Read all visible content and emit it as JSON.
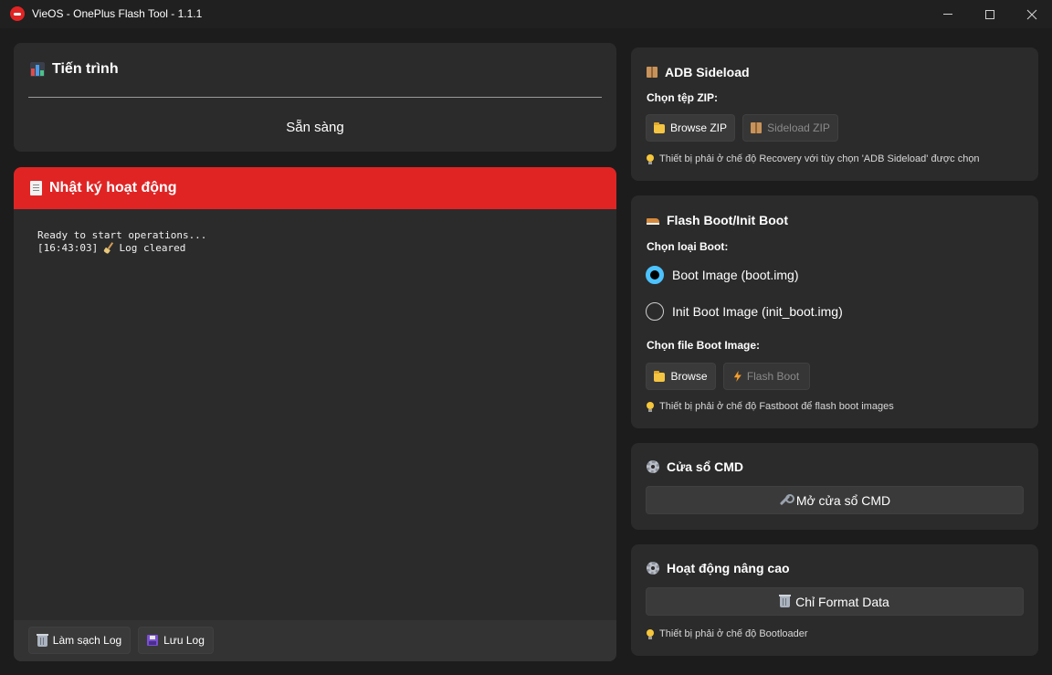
{
  "window": {
    "title": "VieOS - OnePlus Flash Tool - 1.1.1",
    "icon": "vieos-logo-icon",
    "controls": [
      "minimize-icon",
      "maximize-icon",
      "close-icon"
    ]
  },
  "progress": {
    "title": "Tiến trình",
    "icon": "bar-chart-icon",
    "value": 0,
    "status": "Sẵn sàng"
  },
  "log": {
    "title": "Nhật ký hoạt động",
    "icon": "clipboard-icon",
    "header_color": "#e02424",
    "line1": "Ready to start operations...",
    "line2_time": "[16:43:03]",
    "line2_text": "Log cleared",
    "clear_button": "Làm sạch Log",
    "save_button": "Lưu Log"
  },
  "adb": {
    "title": "ADB Sideload",
    "icon": "package-icon",
    "label": "Chọn tệp ZIP:",
    "browse_button": "Browse ZIP",
    "sideload_button": "Sideload ZIP",
    "hint": "Thiết bị phải ở chế độ Recovery với tùy chọn 'ADB Sideload' được chọn"
  },
  "boot": {
    "title": "Flash Boot/Init Boot",
    "icon": "boot-shoe-icon",
    "type_label": "Chọn loại Boot:",
    "option_boot": "Boot Image (boot.img)",
    "option_init": "Init Boot Image (init_boot.img)",
    "selected": "boot",
    "file_label": "Chọn file Boot Image:",
    "browse_button": "Browse",
    "flash_button": "Flash Boot",
    "hint": "Thiết bị phải ở chế độ Fastboot để flash boot images",
    "accent_color": "#4cc2ff"
  },
  "cmd": {
    "title": "Cửa sổ CMD",
    "icon": "gear-icon",
    "open_button": "Mở cửa sổ CMD"
  },
  "advanced": {
    "title": "Hoạt động nâng cao",
    "icon": "gear-icon",
    "format_button": "Chỉ Format Data",
    "hint": "Thiết bị phải ở chế độ Bootloader"
  }
}
